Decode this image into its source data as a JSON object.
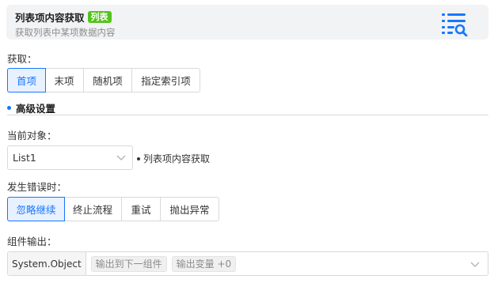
{
  "header": {
    "title": "列表项内容获取",
    "tag": "列表",
    "subtitle": "获取列表中某项数据内容",
    "icon": "list-search-icon",
    "accent": "#1677ff"
  },
  "fetch": {
    "label": "获取：",
    "options": [
      "首项",
      "末项",
      "随机项",
      "指定索引项"
    ],
    "selected": "首项"
  },
  "advanced": {
    "title": "高级设置"
  },
  "current_object": {
    "label": "当前对象：",
    "value": "List1",
    "hint": "列表项内容获取"
  },
  "on_error": {
    "label": "发生错误时：",
    "options": [
      "忽略继续",
      "终止流程",
      "重试",
      "抛出异常"
    ],
    "selected": "忽略继续"
  },
  "output": {
    "label": "组件输出：",
    "type": "System.Object",
    "chips": [
      "输出到下一组件",
      "输出变量 +0"
    ]
  }
}
